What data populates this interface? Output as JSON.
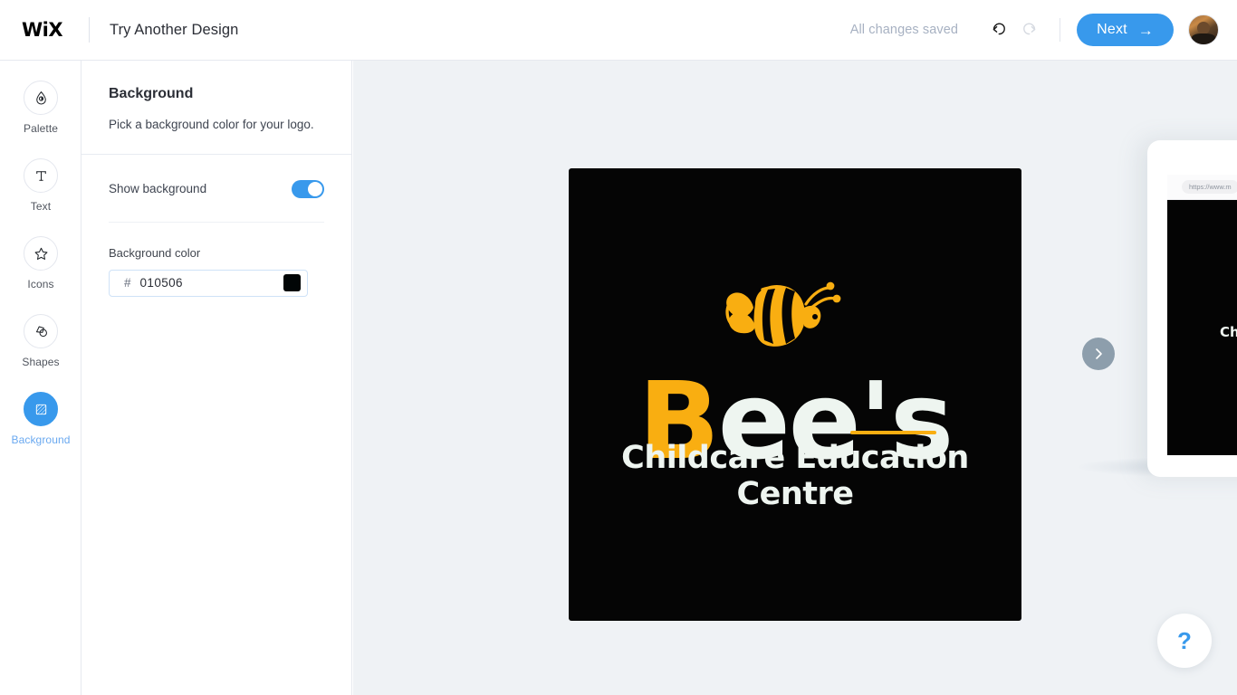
{
  "topbar": {
    "brand": "WiX",
    "title": "Try Another Design",
    "save_status": "All changes saved",
    "undo_icon": "undo-arrow-icon",
    "redo_icon": "redo-arrow-icon",
    "next_label": "Next",
    "next_arrow": "→",
    "avatar_alt": "user-avatar",
    "accent_color": "#3899ec"
  },
  "rail": {
    "items": [
      {
        "label": "Palette",
        "icon": "droplet-icon",
        "active": false
      },
      {
        "label": "Text",
        "icon": "text-t-icon",
        "active": false
      },
      {
        "label": "Icons",
        "icon": "star-icon",
        "active": false
      },
      {
        "label": "Shapes",
        "icon": "shapes-icon",
        "active": false
      },
      {
        "label": "Background",
        "icon": "background-hatch-icon",
        "active": true
      }
    ]
  },
  "panel": {
    "title": "Background",
    "subtitle": "Pick a background color for your logo.",
    "show_background_label": "Show background",
    "show_background_on": true,
    "color_label": "Background color",
    "hash": "#",
    "color_value": "010506",
    "swatch_color": "#010506"
  },
  "canvas": {
    "background_color": "#eff2f5",
    "logo": {
      "background_color": "#050505",
      "brand_first": "B",
      "brand_rest": "ee's",
      "tagline": "Childcare Education Centre",
      "accent_color": "#f9ae11",
      "text_color": "#eef5f0",
      "mark": "bee-icon"
    },
    "device_preview": {
      "url": "https://www.m",
      "visible_text": "Chi"
    },
    "carousel_next_icon": "chevron-right-icon",
    "help_label": "?"
  }
}
